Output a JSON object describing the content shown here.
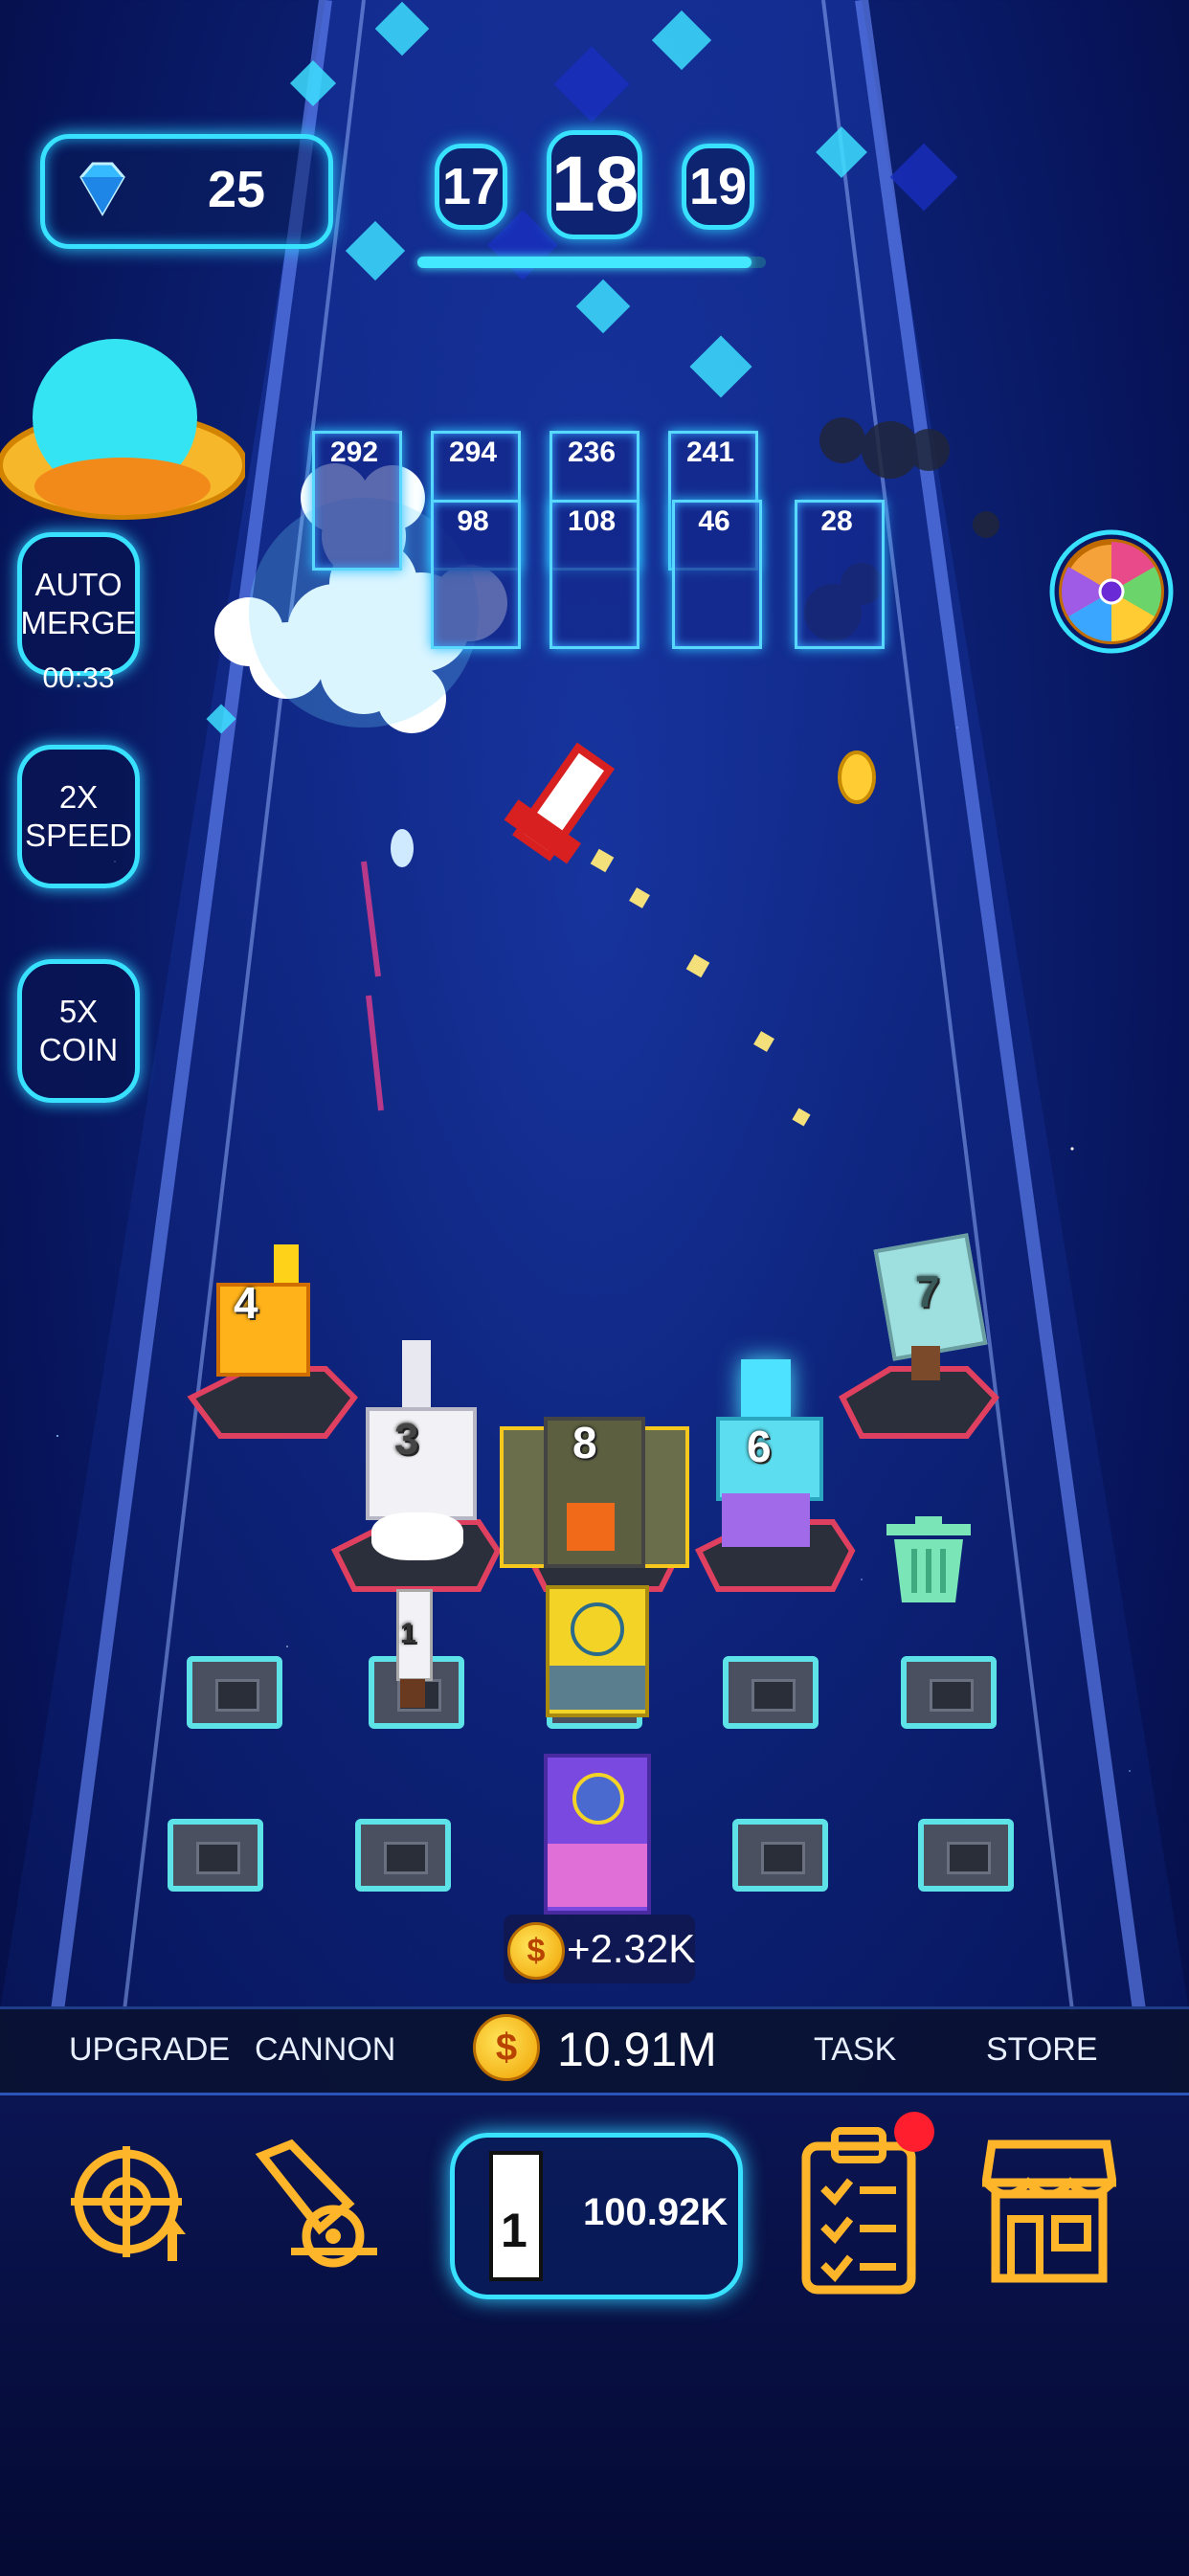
{
  "gems": {
    "count": "25",
    "icon": "diamond-icon"
  },
  "level": {
    "previous": "17",
    "current": "18",
    "next": "19",
    "progress": 0.96
  },
  "side_buttons": {
    "auto_merge": {
      "line1": "AUTO",
      "line2": "MERGE",
      "timer": "00:33"
    },
    "speed": {
      "line1": "2X",
      "line2": "SPEED"
    },
    "coin": {
      "line1": "5X",
      "line2": "COIN"
    }
  },
  "blocks": {
    "row1": [
      "292",
      "294",
      "236",
      "241"
    ],
    "row2": [
      "98",
      "108",
      "46",
      "28"
    ]
  },
  "turrets": {
    "t4": "4",
    "t3": "3",
    "t8": "8",
    "t6": "6",
    "t7": "7",
    "t1": "1"
  },
  "income": {
    "amount": "+2.32K"
  },
  "bar": {
    "upgrade": "UPGRADE",
    "cannon": "CANNON",
    "money": "10.91M",
    "task": "TASK",
    "store": "STORE"
  },
  "buy": {
    "price": "100.92K",
    "level": "1"
  },
  "colors": {
    "accent": "#38e2ff",
    "icon_gold": "#ffb52a",
    "badge": "#ff1e2e"
  }
}
